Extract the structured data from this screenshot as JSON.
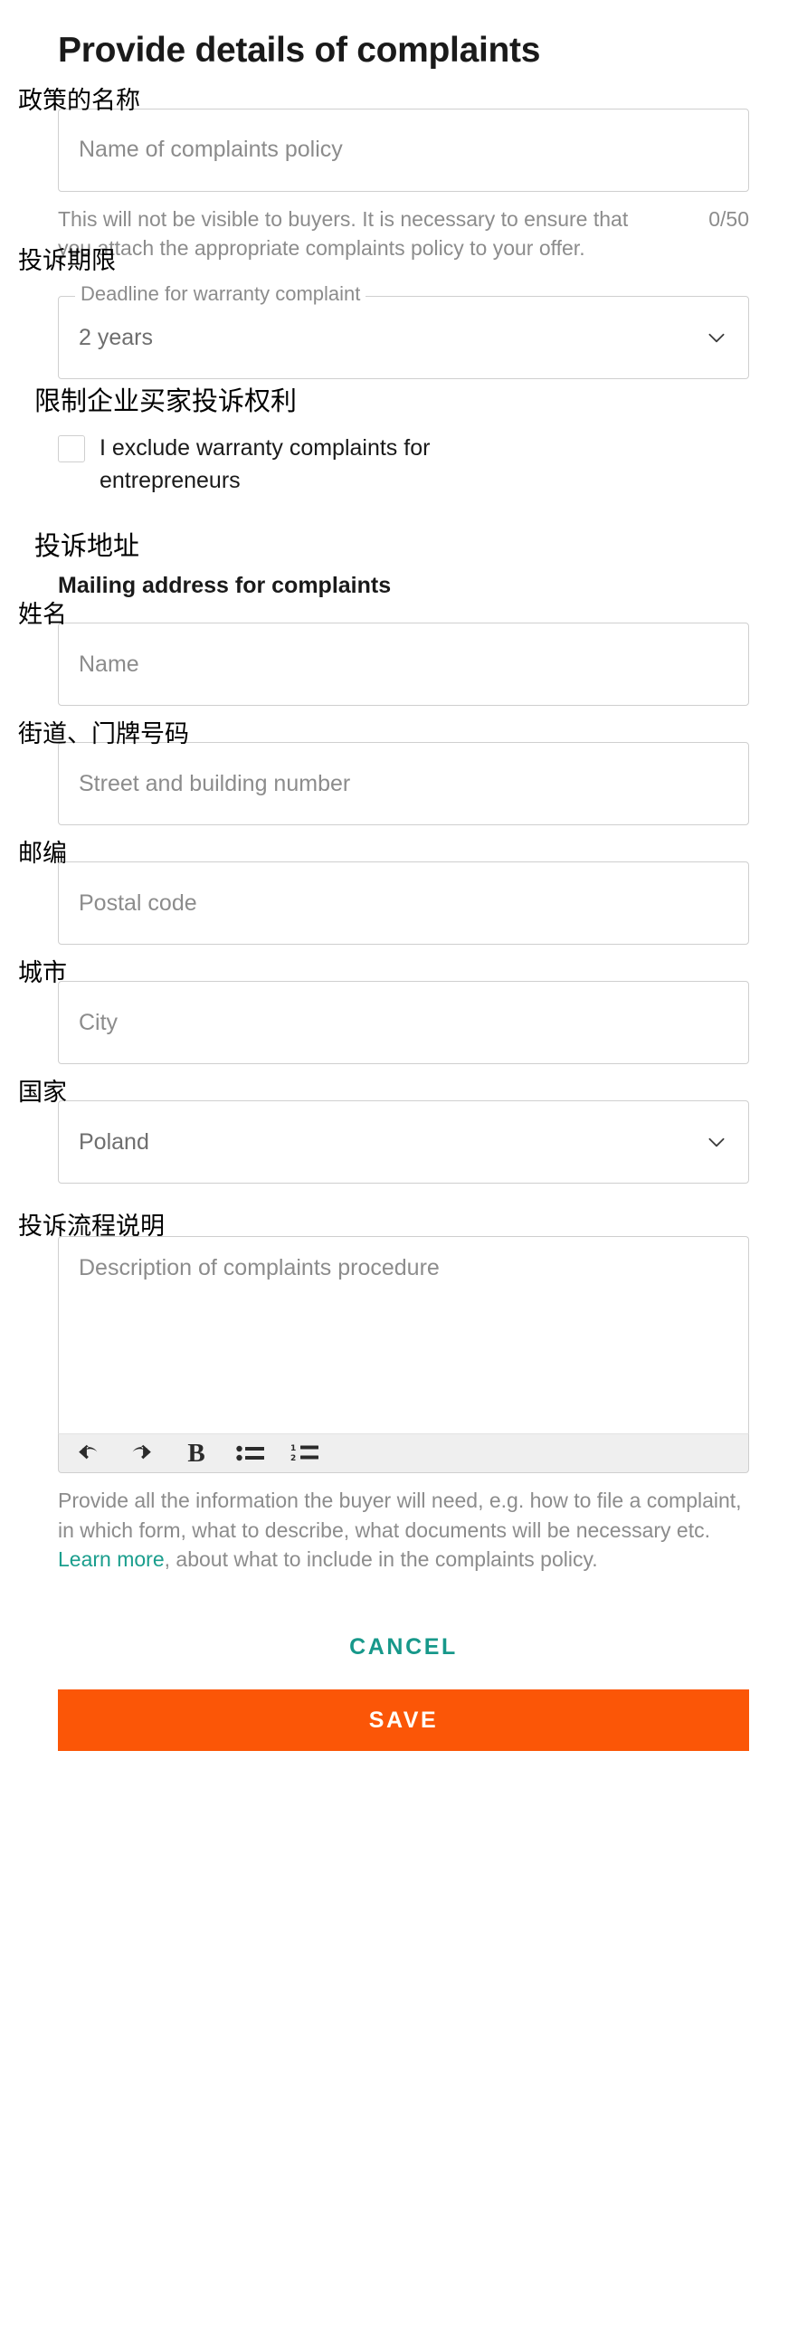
{
  "header": {
    "title": "Provide details of complaints"
  },
  "policy_name": {
    "cn_label": "政策的名称",
    "placeholder": "Name of complaints policy",
    "value": "",
    "helper": "This will not be visible to buyers. It is necessary to ensure that you attach the appropriate complaints policy to your offer.",
    "counter": "0/50"
  },
  "deadline": {
    "cn_label": "投诉期限",
    "legend": "Deadline for warranty complaint",
    "selected": "2 years",
    "chevron_icon": "chevron-down-icon"
  },
  "exclusion": {
    "cn_label": "限制企业买家投诉权利",
    "checkbox_label": "I exclude warranty complaints for entrepreneurs",
    "checked": false
  },
  "address": {
    "cn_label": "投诉地址",
    "subtitle": "Mailing address for complaints",
    "fields": [
      {
        "cn_label": "姓名",
        "placeholder": "Name",
        "value": ""
      },
      {
        "cn_label": "街道、门牌号码",
        "placeholder": "Street and building number",
        "value": ""
      },
      {
        "cn_label": "邮编",
        "placeholder": "Postal code",
        "value": ""
      },
      {
        "cn_label": "城市",
        "placeholder": "City",
        "value": ""
      }
    ],
    "country": {
      "cn_label": "国家",
      "selected": "Poland",
      "chevron_icon": "chevron-down-icon"
    }
  },
  "procedure": {
    "cn_label": "投诉流程说明",
    "placeholder": "Description of complaints procedure",
    "value": "",
    "toolbar": [
      {
        "name": "undo-icon",
        "label": "Undo"
      },
      {
        "name": "redo-icon",
        "label": "Redo"
      },
      {
        "name": "bold-icon",
        "label": "B"
      },
      {
        "name": "bulleted-list-icon",
        "label": "Bulleted list"
      },
      {
        "name": "numbered-list-icon",
        "label": "Numbered list"
      }
    ],
    "helper_before": "Provide all the information the buyer will need, e.g. how to file a complaint, in which form, what to describe, what documents will be necessary etc. ",
    "helper_link": "Learn more",
    "helper_after": ", about what to include in the complaints policy."
  },
  "actions": {
    "cancel_label": "CANCEL",
    "save_label": "SAVE"
  },
  "colors": {
    "accent_teal": "#17988a",
    "save_orange": "#fb5607",
    "link_teal": "#1a9e8d",
    "border_gray": "#cfcfcf",
    "muted_text": "#8c8c8c",
    "toolbar_bg": "#efefef"
  }
}
